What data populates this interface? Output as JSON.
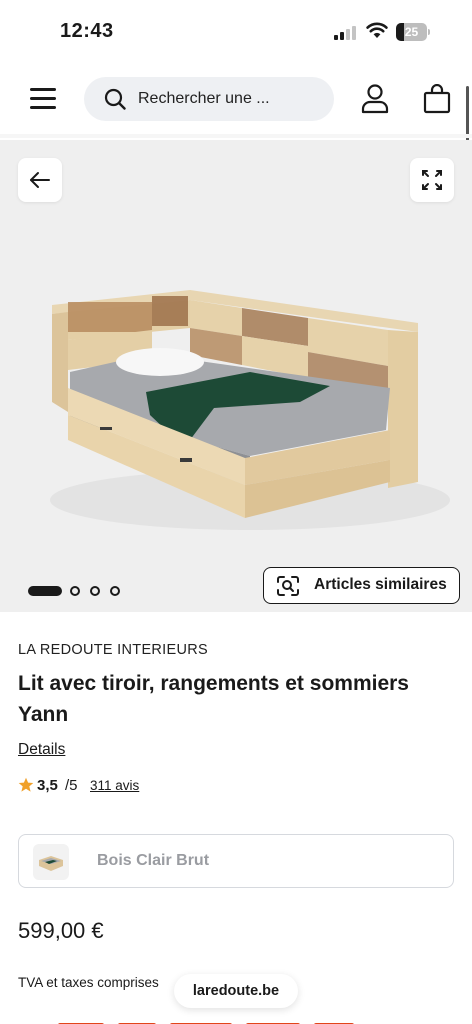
{
  "status_bar": {
    "time": "12:43",
    "battery_level": "25"
  },
  "header": {
    "search_placeholder": "Rechercher une ...",
    "icons": [
      "menu-icon",
      "search-icon",
      "user-icon",
      "bag-icon"
    ]
  },
  "hero": {
    "icons": [
      "arrow-left-icon",
      "expand-icon",
      "visual-search-icon"
    ],
    "carousel": {
      "total_slides": 4,
      "active_slide": 1
    },
    "similar_label": "Articles similaires"
  },
  "product": {
    "brand": "LA REDOUTE INTERIEURS",
    "title": "Lit avec tiroir, rangements et sommiers Yann",
    "details_link": "Details",
    "rating": {
      "value": "3,5",
      "max": "/5",
      "reviews": "311 avis",
      "star_color": "#f0a12b"
    },
    "variant_name": "Bois Clair Brut",
    "price": "599,00 €",
    "tax_note": "TVA et taxes comprises"
  },
  "browser": {
    "url": "laredoute.be"
  },
  "colors": {
    "text": "#1a1a1a",
    "hero_bg": "#efefef",
    "search_bg": "#eef0f3",
    "muted_text": "#9a9ca1",
    "accent": "#e2451a"
  }
}
